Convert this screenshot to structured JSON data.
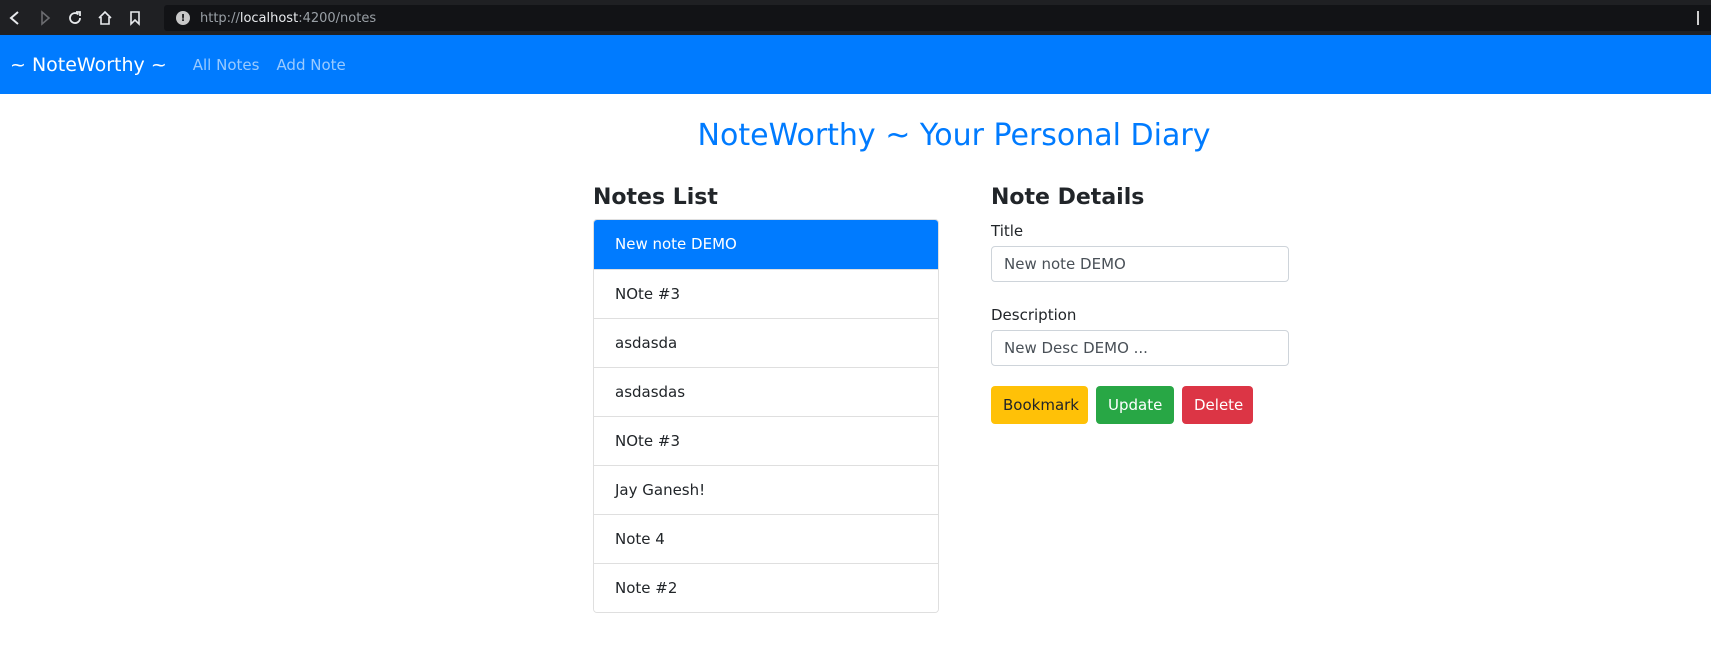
{
  "browser": {
    "url_scheme": "http://",
    "url_host": "localhost",
    "url_path": ":4200/notes",
    "icons": [
      "back-icon",
      "forward-icon",
      "reload-icon",
      "home-icon",
      "bookmark-icon",
      "info-icon"
    ]
  },
  "navbar": {
    "brand": "~ NoteWorthy ~",
    "links": [
      "All Notes",
      "Add Note"
    ]
  },
  "page": {
    "title": "NoteWorthy ~ Your Personal Diary"
  },
  "notes_list": {
    "heading": "Notes List",
    "items": [
      "New note DEMO",
      "NOte #3",
      "asdasda",
      "asdasdas",
      "NOte #3",
      "Jay Ganesh!",
      "Note 4",
      "Note #2"
    ],
    "active_index": 0
  },
  "note_details": {
    "heading": "Note Details",
    "title_label": "Title",
    "title_value": "New note DEMO",
    "description_label": "Description",
    "description_value": "New Desc DEMO ...",
    "buttons": {
      "bookmark": "Bookmark",
      "update": "Update",
      "delete": "Delete"
    }
  },
  "colors": {
    "primary": "#007bff",
    "warning": "#ffc107",
    "success": "#28a745",
    "danger": "#dc3545"
  }
}
